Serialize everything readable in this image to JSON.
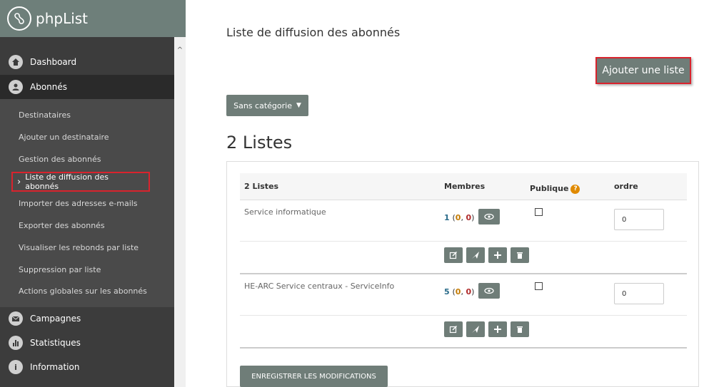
{
  "app": {
    "name": "phpList"
  },
  "sidebar": {
    "main_items": [
      {
        "label": "Dashboard",
        "icon": "home-icon"
      },
      {
        "label": "Abonnés",
        "icon": "user-icon"
      },
      {
        "label": "Campagnes",
        "icon": "envelope-icon"
      },
      {
        "label": "Statistiques",
        "icon": "bar-chart-icon"
      },
      {
        "label": "Information",
        "icon": "info-icon"
      }
    ],
    "sub_items": [
      "Destinataires",
      "Ajouter un destinataire",
      "Gestion des abonnés",
      "Liste de diffusion des abonnés",
      "Importer des adresses e-mails",
      "Exporter des abonnés",
      "Visualiser les rebonds par liste",
      "Suppression par liste",
      "Actions globales sur les abonnés"
    ]
  },
  "main": {
    "page_title": "Liste de diffusion des abonnés",
    "add_list_label": "Ajouter une liste",
    "category_label": "Sans catégorie",
    "lists_heading": "2 Listes",
    "table": {
      "headers": {
        "name": "2 Listes",
        "members": "Membres",
        "public": "Publique",
        "order": "ordre"
      },
      "rows": [
        {
          "name": "Service informatique",
          "members_total": "1",
          "members_a": "0",
          "members_b": "0",
          "order": "0"
        },
        {
          "name": "HE-ARC Service centraux - ServiceInfo",
          "members_total": "5",
          "members_a": "0",
          "members_b": "0",
          "order": "0"
        }
      ]
    },
    "save_label": "ENREGISTRER LES MODIFICATIONS"
  },
  "colors": {
    "sidebar": "#3c3c3c",
    "button": "#6f7d78",
    "highlight": "#d9232d",
    "help": "#e08a00"
  }
}
